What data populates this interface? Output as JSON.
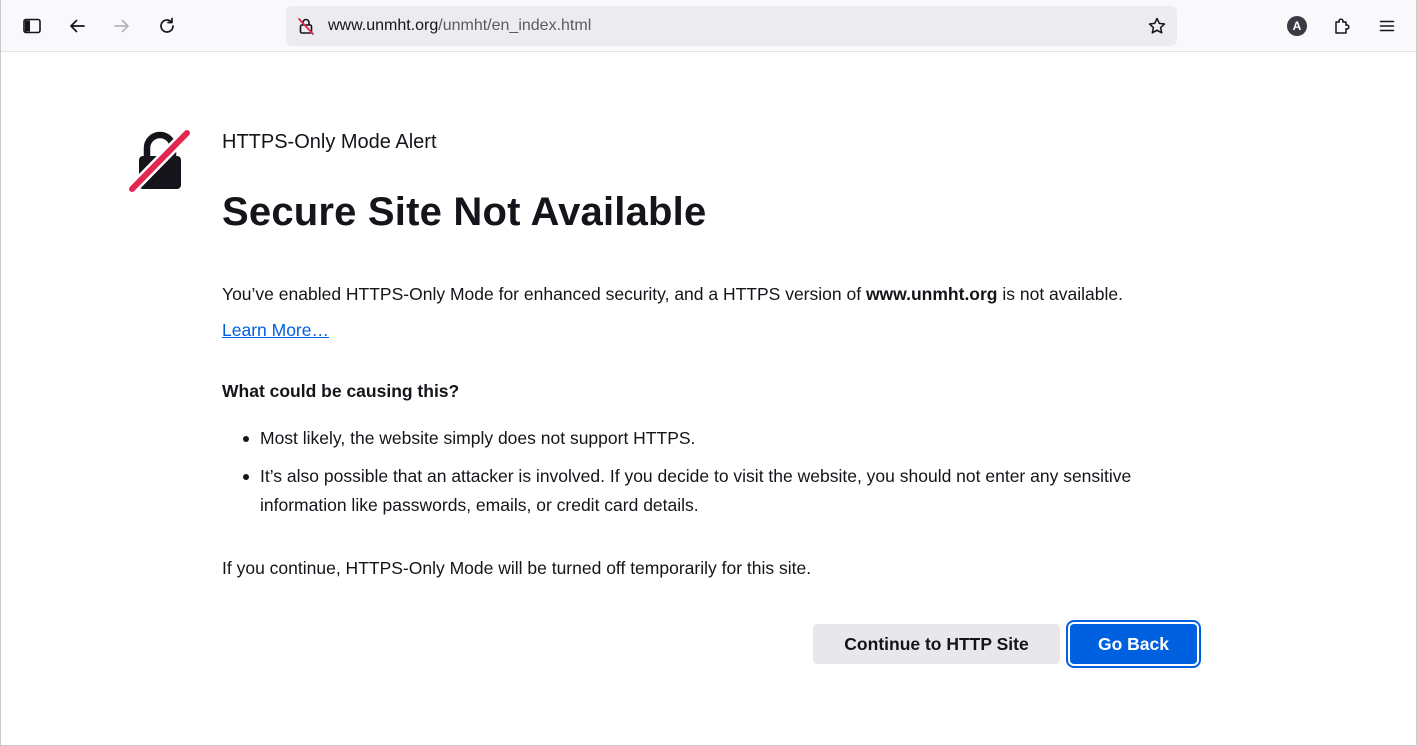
{
  "browser": {
    "url_host": "www.unmht.org",
    "url_path": "/unmht/en_index.html",
    "account_initial": "A",
    "icons": {
      "sidebar": "sidebar-icon",
      "back": "arrow-left-icon",
      "forward": "arrow-right-icon",
      "reload": "reload-icon",
      "insecure": "insecure-lock-icon",
      "bookmark": "star-icon",
      "account": "account-icon",
      "extensions": "puzzle-icon",
      "menu": "hamburger-menu-icon"
    }
  },
  "page": {
    "alert_title": "HTTPS-Only Mode Alert",
    "title": "Secure Site Not Available",
    "description_prefix": "You’ve enabled HTTPS-Only Mode for enhanced security, and a HTTPS version of ",
    "description_host": "www.unmht.org",
    "description_suffix": " is not available.",
    "learn_more": "Learn More…",
    "cause_heading": "What could be causing this?",
    "causes": [
      "Most likely, the website simply does not support HTTPS.",
      "It’s also possible that an attacker is involved. If you decide to visit the website, you should not enter any sensitive information like passwords, emails, or credit card details."
    ],
    "continue_note": "If you continue, HTTPS-Only Mode will be turned off temporarily for this site.",
    "continue_button": "Continue to HTTP Site",
    "back_button": "Go Back",
    "icon": "broken-lock-icon"
  },
  "colors": {
    "accent": "#0061e0",
    "lock_slash": "#e22850",
    "toolbar_bg": "#f9f9fb",
    "urlbar_bg": "#ecebef"
  }
}
